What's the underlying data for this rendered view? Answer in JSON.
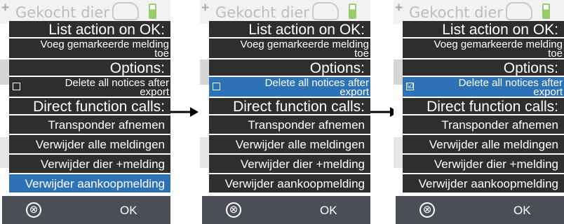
{
  "background": {
    "title": "Gekocht dier"
  },
  "menu": {
    "heading_list_action": "List action on OK:",
    "add_marked_line1": "Voeg gemarkeerde melding",
    "add_marked_line2": "toe",
    "heading_options": "Options:",
    "delete_notices_line1": "Delete all notices after",
    "delete_notices_line2": "export",
    "heading_direct": "Direct function calls:",
    "items": [
      "Transponder afnemen",
      "Verwijder alle meldingen",
      "Verwijder dier +melding",
      "Verwijder aankoopmelding"
    ]
  },
  "bottom_bar": {
    "close_glyph": "⊗",
    "ok_label": "OK"
  },
  "checkbox": {
    "unchecked": "",
    "checked": "☑"
  },
  "screens": [
    {
      "selected": "item-4",
      "delete_notices_checked": false
    },
    {
      "selected": "delete-notices",
      "delete_notices_checked": false
    },
    {
      "selected": "delete-notices",
      "delete_notices_checked": true
    }
  ],
  "colors": {
    "menu_bg": "#2e2e2e",
    "selected_bg": "#2e72b6",
    "bottom_bar_bg": "#4b4f55"
  }
}
